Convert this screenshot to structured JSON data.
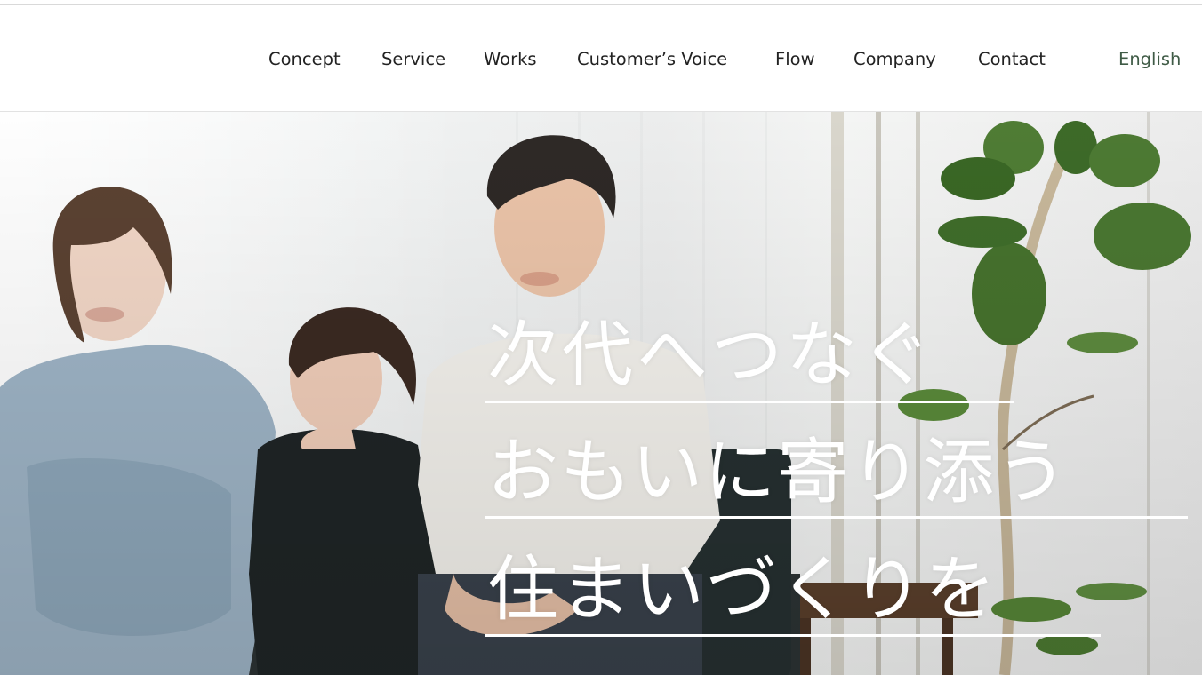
{
  "nav": {
    "items": [
      {
        "label": "Concept"
      },
      {
        "label": "Service"
      },
      {
        "label": "Works"
      },
      {
        "label": "Customer’s Voice"
      },
      {
        "label": "Flow"
      },
      {
        "label": "Company"
      },
      {
        "label": "Contact"
      }
    ],
    "language_label": "English"
  },
  "hero": {
    "headline": [
      "次代へつなぐ",
      "おもいに寄り添う",
      "住まいづくりを"
    ],
    "image_subject": "family-sitting-photo"
  },
  "colors": {
    "nav_text": "#222222",
    "language_text": "#3f5b46",
    "headline_text": "#ffffff"
  }
}
